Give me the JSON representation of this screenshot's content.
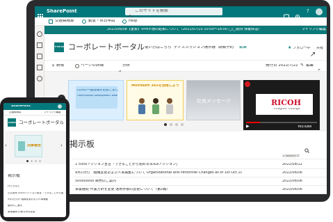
{
  "app": {
    "suite_name": "SharePoint",
    "search_placeholder": "このサイトを検索",
    "brand_color": "#03787c"
  },
  "toolbar": {
    "item1": "交通費精算",
    "item2": "勤怠・休日申請",
    "item3": "Help",
    "right_label": "マイリンク編集"
  },
  "banner": {
    "text": "2021/06/08【重要】VPN不通の結束について（2021/07/10 10:00〜18:00 ◯◯拠点 移動障害）"
  },
  "site": {
    "logo_text": "PORTAL",
    "title": "コーポレートポータル",
    "nav": [
      "使い方はこちら",
      "ディスカッション掲示板",
      "設備予約",
      "編集"
    ],
    "follow_label": "フォロー中",
    "share_label": "共有"
  },
  "cmdbar": {
    "new_label": "新規",
    "details_label": "ページの詳細",
    "analytics_label": "分析",
    "published_label": "発行日 2022/7/22",
    "edit_label": "編集"
  },
  "hero": {
    "card1_title": "CDSの一般情報を更新しました",
    "card1_sub": "Omnichannel Development Team",
    "card2_title": "Microsoft 365を活用しよう",
    "card3_title": "社長メッセージ",
    "video_brand": "RICOH",
    "video_tagline": "imagine. change.",
    "video_service": "YouTube"
  },
  "news": {
    "title": "掲示板",
    "date_header": "公開開始日",
    "rows": [
      {
        "text": "1 500kアクション宣言「できることから始めるSDGsアクション」",
        "date": "2022/08/12"
      },
      {
        "text": "9月1日付　組織変更および人事異動について Organizational and Personnel Changes as of 1st Oct 2021",
        "date": "2022/06/06"
      },
      {
        "text": "500xxxxxx 販売のご案内",
        "date": "2022/06/06"
      },
      {
        "text": "事業継続 作業方針を変更 運用手順の変更について（第2報）",
        "date": "2022/06/06"
      }
    ]
  },
  "phone": {
    "suite_name": "SharePoint",
    "toolbar_item1": "交通費精算",
    "toolbar_right": "マイリンク編集",
    "site_title": "コーポレートポータル",
    "logo_text": "PORTAL",
    "card_title": "決算報告",
    "news_title": "掲示板",
    "news_rows": [
      "作り方など",
      "公式配布 SDGsアクション宣言「できることから始める」",
      "9月1日付け 組織変更および人事異動",
      "販売のご案内",
      "事業継続 作業方針を変更"
    ]
  }
}
